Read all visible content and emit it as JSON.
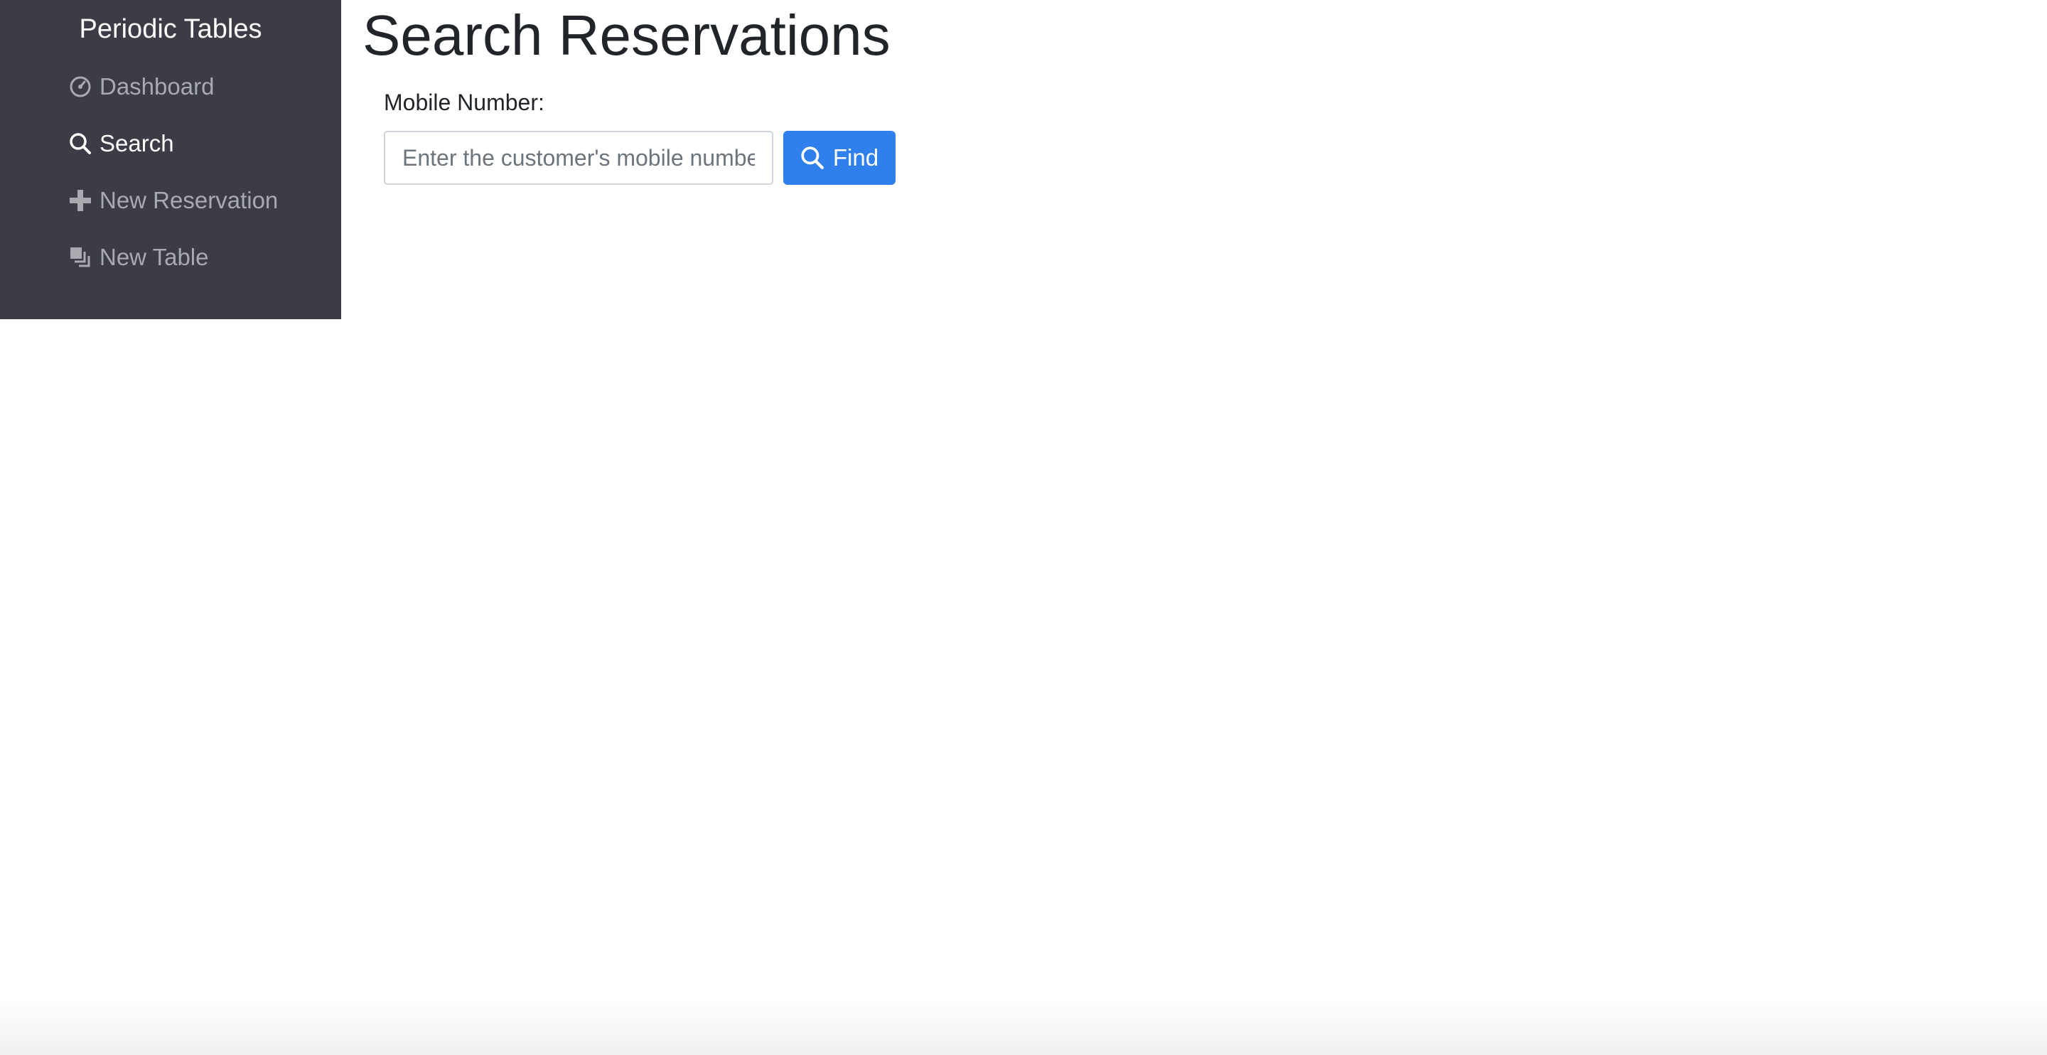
{
  "sidebar": {
    "brand": "Periodic Tables",
    "items": [
      {
        "label": "Dashboard",
        "icon": "dashboard-icon",
        "active": false
      },
      {
        "label": "Search",
        "icon": "search-icon",
        "active": true
      },
      {
        "label": "New Reservation",
        "icon": "plus-icon",
        "active": false
      },
      {
        "label": "New Table",
        "icon": "table-icon",
        "active": false
      }
    ]
  },
  "main": {
    "title": "Search Reservations",
    "mobile_label": "Mobile Number:",
    "mobile_placeholder": "Enter the customer's mobile number",
    "mobile_value": "",
    "find_label": "Find"
  },
  "colors": {
    "sidebar_bg": "#3b3c46",
    "accent": "#2f80ed",
    "nav_inactive": "#a9aab0",
    "nav_active": "#ffffff"
  }
}
